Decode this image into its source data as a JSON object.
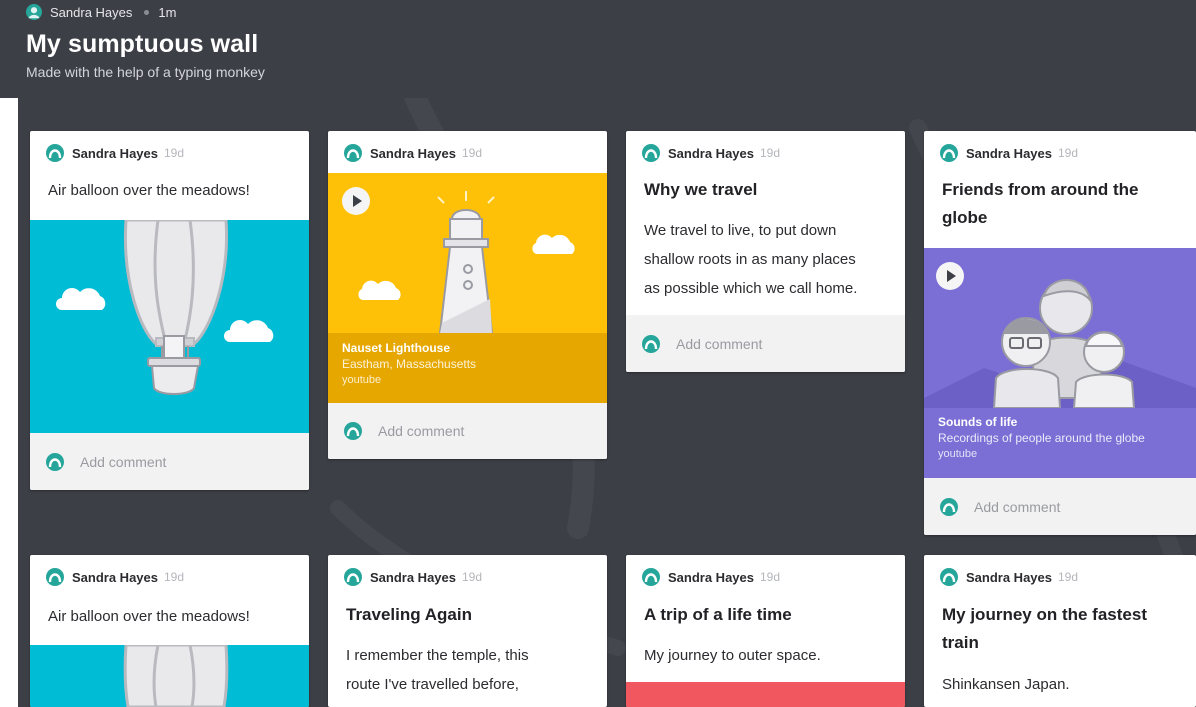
{
  "wall": {
    "top_author": "Sandra Hayes",
    "top_age": "1m",
    "title": "My sumptuous wall",
    "subtitle": "Made with the help of a typing monkey",
    "background": "#3d3f47"
  },
  "colors": {
    "avatar": "#26a69a",
    "sky_blue": "#00bcd4",
    "yellow": "#ffc107",
    "yellow_dark": "#e6a800",
    "purple": "#7b6fd6",
    "red": "#f0575e"
  },
  "cards": [
    {
      "author": "Sandra Hayes",
      "age": "19d",
      "text": "Air balloon over the meadows!",
      "comment": "Add comment"
    },
    {
      "author": "Sandra Hayes",
      "age": "19d",
      "media_title": "Nauset Lighthouse",
      "media_sub": "Eastham, Massachusetts",
      "media_src": "youtube",
      "comment": "Add comment"
    },
    {
      "author": "Sandra Hayes",
      "age": "19d",
      "title": "Why we travel",
      "body": [
        "We travel to live, to put down",
        "shallow roots in as many places",
        "as possible which we call home."
      ],
      "comment": "Add comment"
    },
    {
      "author": "Sandra Hayes",
      "age": "19d",
      "title": [
        "Friends from around the",
        "globe"
      ],
      "media_title": "Sounds of life",
      "media_sub": "Recordings of people around the globe",
      "media_src": "youtube",
      "comment": "Add comment"
    },
    {
      "author": "Sandra Hayes",
      "age": "19d",
      "text": "Air balloon over the meadows!"
    },
    {
      "author": "Sandra Hayes",
      "age": "19d",
      "title": "Traveling Again",
      "body": [
        "I remember the temple, this",
        "route I've travelled before,"
      ]
    },
    {
      "author": "Sandra Hayes",
      "age": "19d",
      "title": "A trip of a life time",
      "body": [
        "My journey to outer space."
      ]
    },
    {
      "author": "Sandra Hayes",
      "age": "19d",
      "title": [
        "My journey on the fastest",
        "train"
      ],
      "body": [
        "Shinkansen Japan."
      ]
    }
  ],
  "icons": {
    "avatar": "user-avatar-icon",
    "play": "play-icon",
    "cloud": "cloud-icon"
  }
}
